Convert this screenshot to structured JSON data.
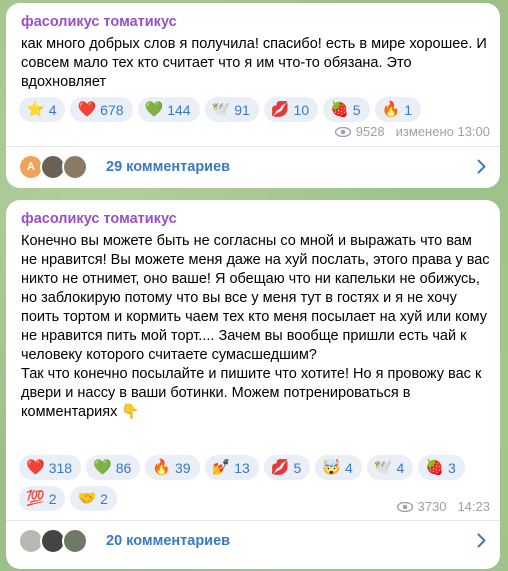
{
  "messages": [
    {
      "author": "фасоликус томатикус",
      "text": "как много добрых слов я получила! спасибо! есть в мире хорошее. И совсем мало тех кто считает что я им что-то обязана. Это вдохновляет",
      "reactions": [
        {
          "emoji": "⭐",
          "count": "4"
        },
        {
          "emoji": "❤️",
          "count": "678"
        },
        {
          "emoji": "💚",
          "count": "144"
        },
        {
          "emoji": "🕊️",
          "count": "91"
        },
        {
          "emoji": "💋",
          "count": "10"
        },
        {
          "emoji": "🍓",
          "count": "5"
        },
        {
          "emoji": "🔥",
          "count": "1"
        }
      ],
      "views": "9528",
      "time": "изменено 13:00",
      "comments_label": "29 комментариев",
      "avatar_letter": "A"
    },
    {
      "author": "фасоликус томатикус",
      "text": "Конечно вы можете быть не согласны со мной и выражать что вам не нравится! Вы можете меня даже на хуй послать, этого права у вас никто не отнимет, оно ваше! Я обещаю что ни капельки не обижусь, но заблокирую потому что вы все у меня тут в гостях и я не хочу поить тортом и кормить чаем тех кто меня посылает на хуй или кому не нравится пить мой торт.... Зачем вы вообще пришли есть чай к человеку которого считаете сумасшедшим?\nТак что конечно посылайте и пишите что хотите! Но я провожу вас к двери и нассу в ваши ботинки. Можем потренироваться в комментариях 👇",
      "reactions": [
        {
          "emoji": "❤️",
          "count": "318"
        },
        {
          "emoji": "💚",
          "count": "86"
        },
        {
          "emoji": "🔥",
          "count": "39"
        },
        {
          "emoji": "💅",
          "count": "13"
        },
        {
          "emoji": "💋",
          "count": "5"
        },
        {
          "emoji": "🤯",
          "count": "4"
        },
        {
          "emoji": "🕊️",
          "count": "4"
        },
        {
          "emoji": "🍓",
          "count": "3"
        },
        {
          "emoji": "💯",
          "count": "2"
        },
        {
          "emoji": "🤝",
          "count": "2"
        }
      ],
      "views": "3730",
      "time": "14:23",
      "comments_label": "20 комментариев"
    }
  ],
  "colors": {
    "accent": "#3a79c6",
    "author": "#9b4fc4",
    "chip_bg": "#e9eef7",
    "meta": "#9aa2aa"
  }
}
